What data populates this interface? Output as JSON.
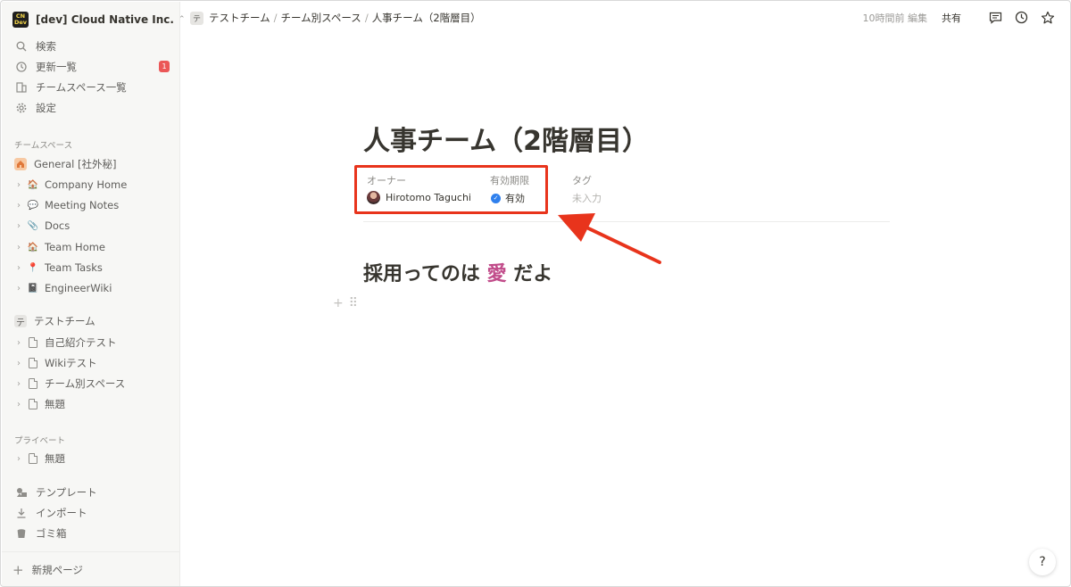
{
  "workspace": {
    "logo_top": "CN",
    "logo_bottom": "Dev",
    "name": "[dev] Cloud Native Inc."
  },
  "sidebar": {
    "nav": [
      {
        "label": "検索",
        "icon": "search-icon"
      },
      {
        "label": "更新一覧",
        "icon": "clock-icon",
        "badge": "1"
      },
      {
        "label": "チームスペース一覧",
        "icon": "building-icon"
      },
      {
        "label": "設定",
        "icon": "gear-icon"
      }
    ],
    "teamspace_title": "チームスペース",
    "general": "General [社外秘]",
    "general_items": [
      "Company Home",
      "Meeting Notes",
      "Docs",
      "Team Home",
      "Team Tasks",
      "EngineerWiki"
    ],
    "team_icon_char": "テ",
    "team": "テストチーム",
    "team_items": [
      "自己紹介テスト",
      "Wikiテスト",
      "チーム別スペース",
      "無題"
    ],
    "private_title": "プライベート",
    "private_items": [
      "無題"
    ],
    "bottom": [
      {
        "label": "テンプレート",
        "icon": "template-icon"
      },
      {
        "label": "インポート",
        "icon": "import-icon"
      },
      {
        "label": "ゴミ箱",
        "icon": "trash-icon"
      }
    ],
    "new_page": "新規ページ"
  },
  "topbar": {
    "crumbs": [
      "テストチーム",
      "チーム別スペース",
      "人事チーム（2階層目）"
    ],
    "edited": "10時間前 編集",
    "share": "共有"
  },
  "page": {
    "title": "人事チーム（2階層目）",
    "props": {
      "owner_label": "オーナー",
      "owner_value": "Hirotomo Taguchi",
      "validity_label": "有効期限",
      "validity_value": "有効",
      "tag_label": "タグ",
      "tag_value": "未入力"
    },
    "heading_pre": "採用ってのは ",
    "heading_emph": "愛",
    "heading_post": " だよ"
  },
  "help": "?",
  "colors": {
    "annotation": "#e8341c",
    "badge": "#eb5757",
    "verified": "#2f80ed",
    "emphasis": "#c14c8a"
  }
}
